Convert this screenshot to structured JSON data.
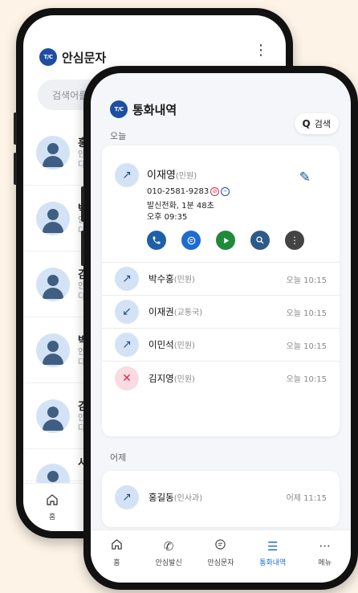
{
  "back_app": {
    "title": "안심문자",
    "search_placeholder": "검색어를 입",
    "contacts": [
      {
        "name": "홍길",
        "line1": "안녕",
        "line2": "다음"
      },
      {
        "name": "박정",
        "line1": "안녕",
        "line2": "다음"
      },
      {
        "name": "김성",
        "line1": "안녕",
        "line2": "다음"
      },
      {
        "name": "박수",
        "line1": "안녕",
        "line2": "다음"
      },
      {
        "name": "김수",
        "line1": "안녕",
        "line2": "다음"
      },
      {
        "name": "시티",
        "line1": "",
        "line2": ""
      }
    ],
    "nav_home": "홈"
  },
  "front_app": {
    "logo": "T/C",
    "title": "통화내역",
    "search_label": "검색",
    "today_label": "오늘",
    "yesterday_label": "어제",
    "expanded_call": {
      "name": "이재영",
      "dept": "(민원)",
      "number": "010-2581-9283",
      "detail": "발신전화, 1분 48초",
      "time": "오후 09:35"
    },
    "calls_today": [
      {
        "name": "박수홍",
        "dept": "(민원)",
        "time": "오늘 10:15",
        "type": "outgoing"
      },
      {
        "name": "이재권",
        "dept": "(교통국)",
        "time": "오늘 10:15",
        "type": "incoming"
      },
      {
        "name": "이민석",
        "dept": "(민원)",
        "time": "오늘 10:15",
        "type": "outgoing"
      },
      {
        "name": "김지영",
        "dept": "(민원)",
        "time": "오늘 10:15",
        "type": "missed"
      }
    ],
    "calls_yesterday": [
      {
        "name": "홍길동",
        "dept": "(인사과)",
        "time": "어제 11:15",
        "type": "outgoing"
      }
    ],
    "nav": [
      "홈",
      "안심발신",
      "안심문자",
      "통화내역",
      "메뉴"
    ],
    "active_nav": "통화내역",
    "colors": {
      "brand": "#1d4fa0",
      "active": "#1e6bd1",
      "call": "#1e5fa8",
      "message": "#1e6bd1",
      "play": "#1f8a3a",
      "search": "#2d5a8a",
      "more": "#444444"
    }
  }
}
